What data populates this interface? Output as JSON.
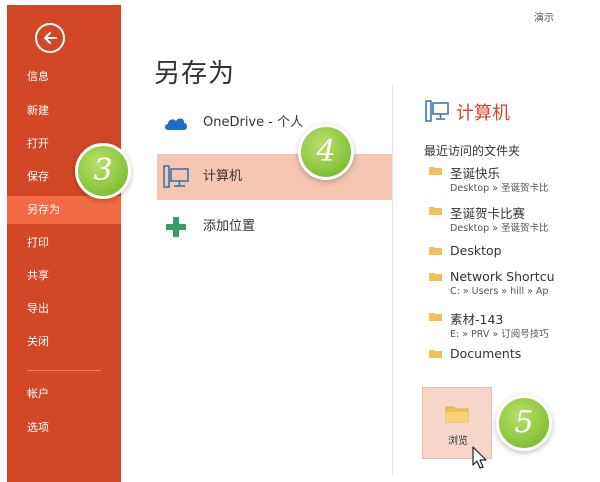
{
  "app_title": "演示",
  "sidebar": {
    "items": [
      {
        "label": "信息",
        "active": false
      },
      {
        "label": "新建",
        "active": false
      },
      {
        "label": "打开",
        "active": false
      },
      {
        "label": "保存",
        "active": false
      },
      {
        "label": "另存为",
        "active": true
      },
      {
        "label": "打印",
        "active": false
      },
      {
        "label": "共享",
        "active": false
      },
      {
        "label": "导出",
        "active": false
      },
      {
        "label": "关闭",
        "active": false
      },
      {
        "label": "帐户",
        "active": false
      },
      {
        "label": "选项",
        "active": false
      }
    ]
  },
  "page_title": "另存为",
  "places": [
    {
      "label": "OneDrive - 个人",
      "icon": "cloud-icon",
      "selected": false
    },
    {
      "label": "计算机",
      "icon": "computer-icon",
      "selected": true
    },
    {
      "label": "添加位置",
      "icon": "plus-icon",
      "selected": false
    }
  ],
  "panel": {
    "title": "计算机",
    "recent_title": "最近访问的文件夹",
    "folders": [
      {
        "name": "圣诞快乐",
        "path": "Desktop » 圣诞贺卡比"
      },
      {
        "name": "圣诞贺卡比赛",
        "path": "Desktop » 圣诞贺卡比"
      },
      {
        "name": "Desktop",
        "path": ""
      },
      {
        "name": "Network Shortcu",
        "path": "C: » Users » hill » Ap"
      },
      {
        "name": "素材-143",
        "path": "E: » PRV » 订阅号技巧"
      },
      {
        "name": "Documents",
        "path": ""
      }
    ],
    "browse_label": "浏览"
  },
  "badges": [
    "3",
    "4",
    "5"
  ],
  "colors": {
    "sidebar": "#d24726",
    "sidebar_active": "#f26b43",
    "selected_place": "#f6c6b2",
    "badge_green": "#8cc63f",
    "accent_text": "#d24726",
    "folder": "#f0c05a"
  }
}
